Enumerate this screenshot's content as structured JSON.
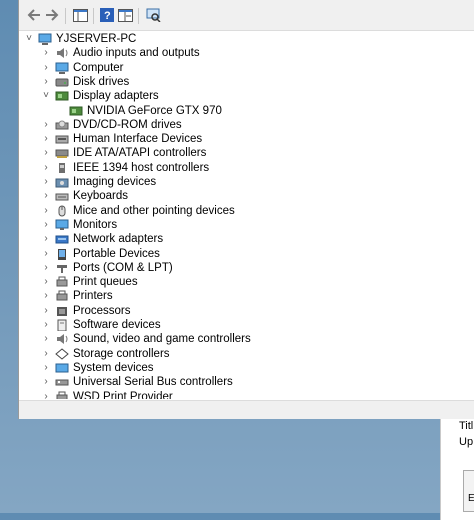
{
  "toolbar": {
    "icons": [
      "back-arrow-icon",
      "forward-arrow-icon",
      "show-hide-console-tree-icon",
      "help-icon",
      "properties-icon",
      "scan-hardware-icon"
    ]
  },
  "tree": {
    "root": "YJSERVER-PC",
    "items": [
      {
        "label": "Audio inputs and outputs",
        "icon": "audio-icon"
      },
      {
        "label": "Computer",
        "icon": "computer-icon"
      },
      {
        "label": "Disk drives",
        "icon": "disk-drive-icon"
      },
      {
        "label": "Display adapters",
        "icon": "display-adapter-icon",
        "expanded": true,
        "children": [
          {
            "label": "NVIDIA GeForce GTX 970",
            "icon": "gpu-icon"
          }
        ]
      },
      {
        "label": "DVD/CD-ROM drives",
        "icon": "dvd-icon"
      },
      {
        "label": "Human Interface Devices",
        "icon": "hid-icon"
      },
      {
        "label": "IDE ATA/ATAPI controllers",
        "icon": "ide-icon"
      },
      {
        "label": "IEEE 1394 host controllers",
        "icon": "ieee1394-icon"
      },
      {
        "label": "Imaging devices",
        "icon": "imaging-icon"
      },
      {
        "label": "Keyboards",
        "icon": "keyboard-icon"
      },
      {
        "label": "Mice and other pointing devices",
        "icon": "mouse-icon"
      },
      {
        "label": "Monitors",
        "icon": "monitor-icon"
      },
      {
        "label": "Network adapters",
        "icon": "network-icon"
      },
      {
        "label": "Portable Devices",
        "icon": "portable-device-icon"
      },
      {
        "label": "Ports (COM & LPT)",
        "icon": "port-icon"
      },
      {
        "label": "Print queues",
        "icon": "print-queue-icon"
      },
      {
        "label": "Printers",
        "icon": "printer-icon"
      },
      {
        "label": "Processors",
        "icon": "processor-icon"
      },
      {
        "label": "Software devices",
        "icon": "software-device-icon"
      },
      {
        "label": "Sound, video and game controllers",
        "icon": "sound-icon"
      },
      {
        "label": "Storage controllers",
        "icon": "storage-icon"
      },
      {
        "label": "System devices",
        "icon": "system-device-icon"
      },
      {
        "label": "Universal Serial Bus controllers",
        "icon": "usb-icon"
      },
      {
        "label": "WSD Print Provider",
        "icon": "wsd-icon"
      }
    ]
  },
  "background_window": {
    "text1": "Titl",
    "text2": "Up"
  },
  "colors": {
    "accent": "#1a5fb4",
    "desktop": "#6f97b9"
  }
}
